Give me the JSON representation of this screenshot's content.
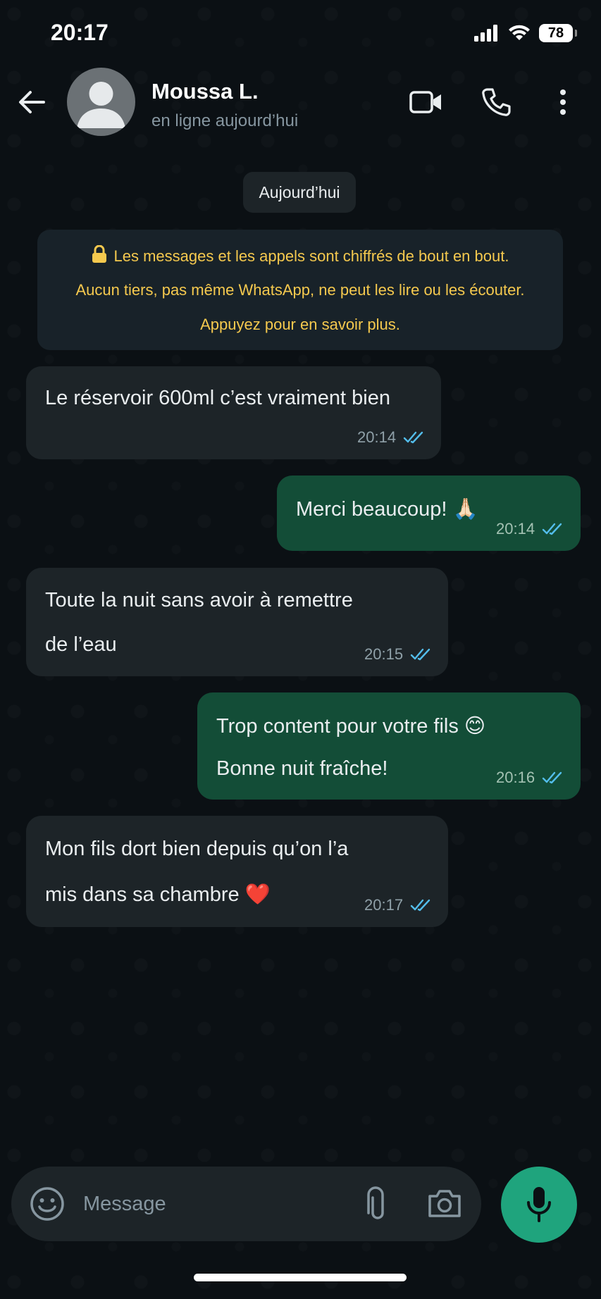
{
  "status_bar": {
    "time": "20:17",
    "battery": "78"
  },
  "header": {
    "contact_name": "Moussa L.",
    "contact_status": "en ligne aujourd’hui"
  },
  "chat": {
    "date_chip": "Aujourd’hui",
    "encryption_notice": {
      "line1": "Les messages et les appels sont chiffrés de bout en bout.",
      "line2": "Aucun tiers, pas même WhatsApp, ne peut les lire ou les écouter.",
      "line3": "Appuyez pour en savoir plus."
    },
    "messages": [
      {
        "direction": "incoming",
        "lines": [
          "Le réservoir 600ml c’est vraiment bien"
        ],
        "time": "20:14",
        "read": true
      },
      {
        "direction": "outgoing",
        "lines": [
          "Merci beaucoup! 🙏🏻"
        ],
        "time": "20:14",
        "read": true
      },
      {
        "direction": "incoming",
        "lines": [
          "Toute la nuit sans avoir à remettre",
          "de l’eau"
        ],
        "time": "20:15",
        "read": true
      },
      {
        "direction": "outgoing",
        "lines": [
          "Trop content pour votre fils 😊",
          "Bonne nuit fraîche!"
        ],
        "time": "20:16",
        "read": true
      },
      {
        "direction": "incoming",
        "lines": [
          "Mon fils dort bien depuis qu’on l’a",
          "mis dans sa chambre ❤️"
        ],
        "time": "20:17",
        "read": true
      }
    ]
  },
  "composer": {
    "placeholder": "Message"
  },
  "colors": {
    "background": "#0b1014",
    "incoming_bubble": "#1d2428",
    "outgoing_bubble": "#134d37",
    "read_ticks": "#53bdeb",
    "encryption_text": "#f5c94e",
    "mic_button": "#1fa47d"
  },
  "icons": [
    "back-arrow-icon",
    "avatar-placeholder-icon",
    "video-call-icon",
    "phone-icon",
    "more-options-icon",
    "lock-icon",
    "double-check-icon",
    "emoji-icon",
    "attach-icon",
    "camera-icon",
    "microphone-icon",
    "signal-icon",
    "wifi-icon",
    "battery-icon"
  ]
}
